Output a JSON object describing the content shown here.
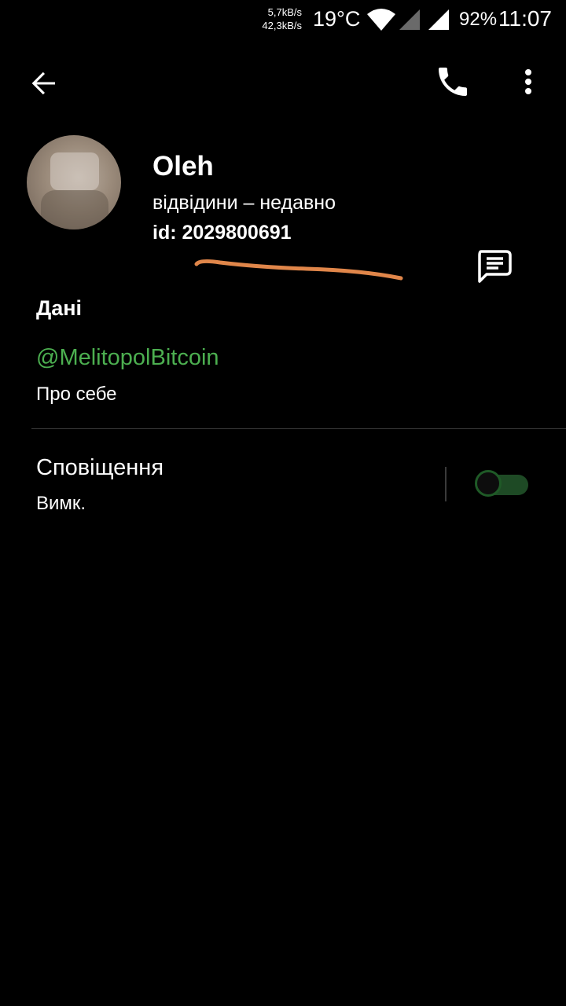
{
  "status_bar": {
    "speed_up": "5,7kB/s",
    "speed_down": "42,3kB/s",
    "temperature": "19°C",
    "battery": "92%",
    "time": "11:07",
    "icons": [
      "wifi-icon",
      "signal-icon",
      "signal-icon"
    ]
  },
  "toolbar": {
    "icons": [
      "arrow-left-icon",
      "phone-icon",
      "more-vertical-icon"
    ]
  },
  "profile": {
    "name": "Oleh",
    "last_seen": "відвідини – недавно",
    "id": "id: 2029800691",
    "annotation_color": "#e0864a"
  },
  "info": {
    "section_title": "Дані",
    "username": "@MelitopolBitcoin",
    "username_caption": "Про себе",
    "link_color": "#4caf50"
  },
  "notifications": {
    "title": "Сповіщення",
    "status": "Вимк.",
    "enabled": false
  }
}
